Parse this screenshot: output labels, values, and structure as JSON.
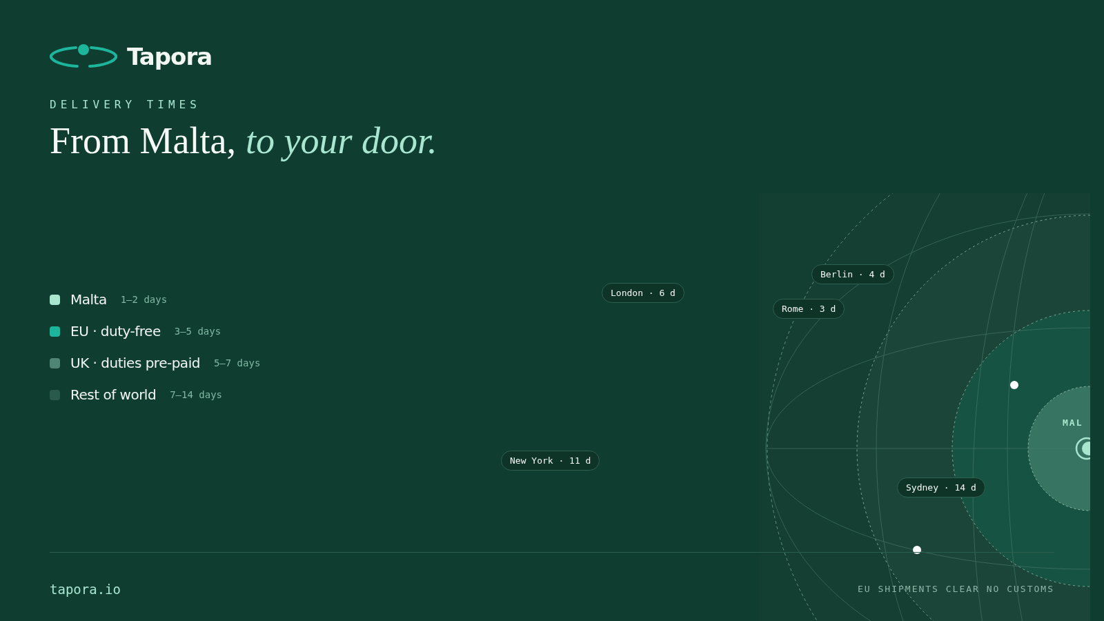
{
  "brand": {
    "name": "Tapora"
  },
  "eyebrow": "DELIVERY TIMES",
  "headline": {
    "main": "From Malta,",
    "accent": "to your door."
  },
  "legend": [
    {
      "label": "Malta",
      "range": "1–2 days",
      "color": "#a8e6cf"
    },
    {
      "label": "EU · duty-free",
      "range": "3–5 days",
      "color": "#1db59c"
    },
    {
      "label": "UK · duties pre-paid",
      "range": "5–7 days",
      "color": "#4e8574"
    },
    {
      "label": "Rest of world",
      "range": "7–14 days",
      "color": "#2a5a4b"
    }
  ],
  "destinations": [
    {
      "label": "Berlin · 4 d"
    },
    {
      "label": "London · 6 d"
    },
    {
      "label": "Rome · 3 d"
    },
    {
      "label": "New York · 11 d"
    },
    {
      "label": "Sydney · 14 d"
    }
  ],
  "globe": {
    "label": "MAL"
  },
  "footer": {
    "site": "tapora.io",
    "note": "EU SHIPMENTS CLEAR NO CUSTOMS"
  }
}
